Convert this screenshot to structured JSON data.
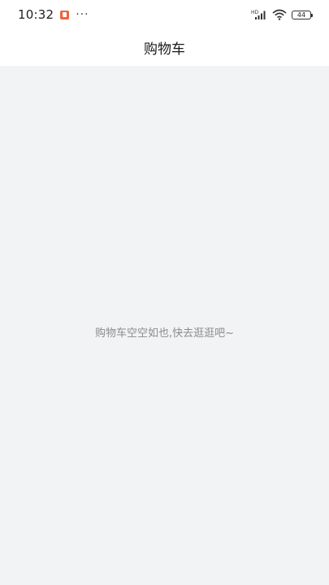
{
  "status_bar": {
    "time": "10:32",
    "more": "···",
    "battery_level": "44",
    "icons": [
      "notification-icon",
      "signal-hd-icon",
      "wifi-icon",
      "battery-icon"
    ]
  },
  "header": {
    "title": "购物车"
  },
  "cart": {
    "empty_message": "购物车空空如也,快去逛逛吧~"
  },
  "colors": {
    "background": "#f2f3f5",
    "header_bg": "#ffffff",
    "empty_text": "#8c8c8c",
    "notification_accent": "#f0643c"
  }
}
